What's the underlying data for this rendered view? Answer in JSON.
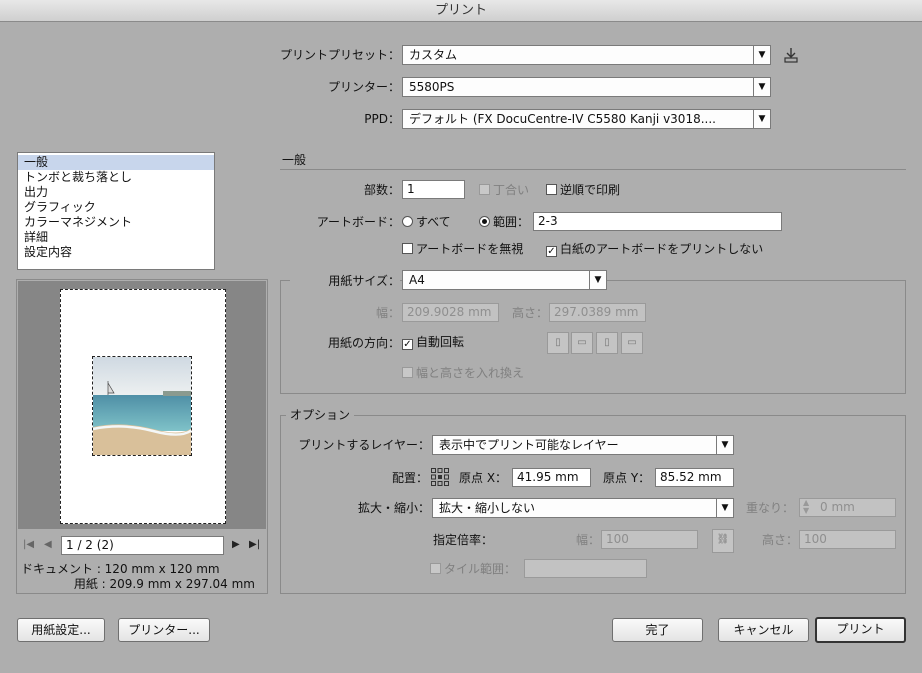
{
  "window": {
    "title": "プリント"
  },
  "top": {
    "preset_label": "プリントプリセット：",
    "preset_value": "カスタム",
    "printer_label": "プリンター：",
    "printer_value": "5580PS",
    "ppd_label": "PPD：",
    "ppd_value": "デフォルト (FX DocuCentre-IV C5580 Kanji v3018...."
  },
  "sidebar": {
    "items": [
      {
        "label": "一般"
      },
      {
        "label": "トンボと裁ち落とし"
      },
      {
        "label": "出力"
      },
      {
        "label": "グラフィック"
      },
      {
        "label": "カラーマネジメント"
      },
      {
        "label": "詳細"
      },
      {
        "label": "設定内容"
      }
    ],
    "selected_index": 0
  },
  "preview": {
    "page_value": "1 / 2 (2)",
    "doc_info": "ドキュメント : 120 mm x 120 mm",
    "paper_info": "用紙 : 209.9 mm x 297.04 mm"
  },
  "general": {
    "section_title": "一般",
    "copies_label": "部数：",
    "copies_value": "1",
    "collate_label": "丁合い",
    "reverse_label": "逆順で印刷",
    "artboard_label": "アートボード：",
    "all_label": "すべて",
    "range_label": "範囲：",
    "range_value": "2-3",
    "ignore_artboards_label": "アートボードを無視",
    "skip_blank_label": "白紙のアートボードをプリントしない"
  },
  "paper": {
    "size_label": "用紙サイズ：",
    "size_value": "A4",
    "width_label": "幅：",
    "width_value": "209.9028 mm",
    "height_label": "高さ：",
    "height_value": "297.0389 mm",
    "orientation_label": "用紙の方向：",
    "auto_rotate_label": "自動回転",
    "swap_label": "幅と高さを入れ換え"
  },
  "options": {
    "title": "オプション",
    "layers_label": "プリントするレイヤー：",
    "layers_value": "表示中でプリント可能なレイヤー",
    "placement_label": "配置：",
    "origin_x_label": "原点 X：",
    "origin_x_value": "41.95 mm",
    "origin_y_label": "原点 Y：",
    "origin_y_value": "85.52 mm",
    "scale_label": "拡大・縮小：",
    "scale_value": "拡大・縮小しない",
    "overlap_label": "重なり：",
    "overlap_value": "0 mm",
    "custom_scale_label": "指定倍率：",
    "scale_w_label": "幅：",
    "scale_w_value": "100",
    "scale_h_label": "高さ：",
    "scale_h_value": "100",
    "tile_label": "タイル範囲："
  },
  "buttons": {
    "page_setup": "用紙設定...",
    "printer": "プリンター...",
    "done": "完了",
    "cancel": "キャンセル",
    "print": "プリント"
  }
}
